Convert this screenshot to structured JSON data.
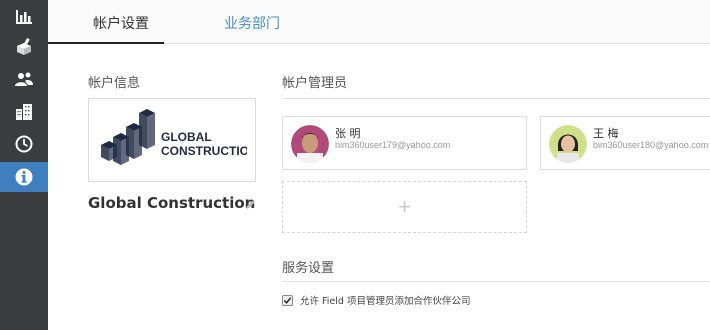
{
  "sidebar": {
    "items": [
      {
        "icon": "bar-chart-icon"
      },
      {
        "icon": "cube-pen-icon"
      },
      {
        "icon": "users-icon"
      },
      {
        "icon": "building-icon"
      },
      {
        "icon": "clock-icon"
      },
      {
        "icon": "info-icon",
        "active": true
      }
    ]
  },
  "tabs": {
    "account_settings": "帐户设置",
    "business_departments": "业务部门"
  },
  "account_info": {
    "label": "帐户信息",
    "logo_line1": "GLOBAL",
    "logo_line2": "CONSTRUCTION",
    "company_name": "Global Construction"
  },
  "admins": {
    "label": "帐户管理员",
    "items": [
      {
        "name": "张 明",
        "email": "bim360user179@yahoo.com"
      },
      {
        "name": "王 梅",
        "email": "bim360user180@yahoo.com"
      }
    ],
    "add_symbol": "+"
  },
  "service": {
    "label": "服务设置",
    "checkbox_label": "允许 Field 项目管理员添加合作伙伴公司",
    "checked": true
  },
  "colors": {
    "sidebar_bg": "#3a3d40",
    "active": "#3f7fbf",
    "link": "#4a8ec9",
    "logo_navy": "#1f2a44"
  }
}
